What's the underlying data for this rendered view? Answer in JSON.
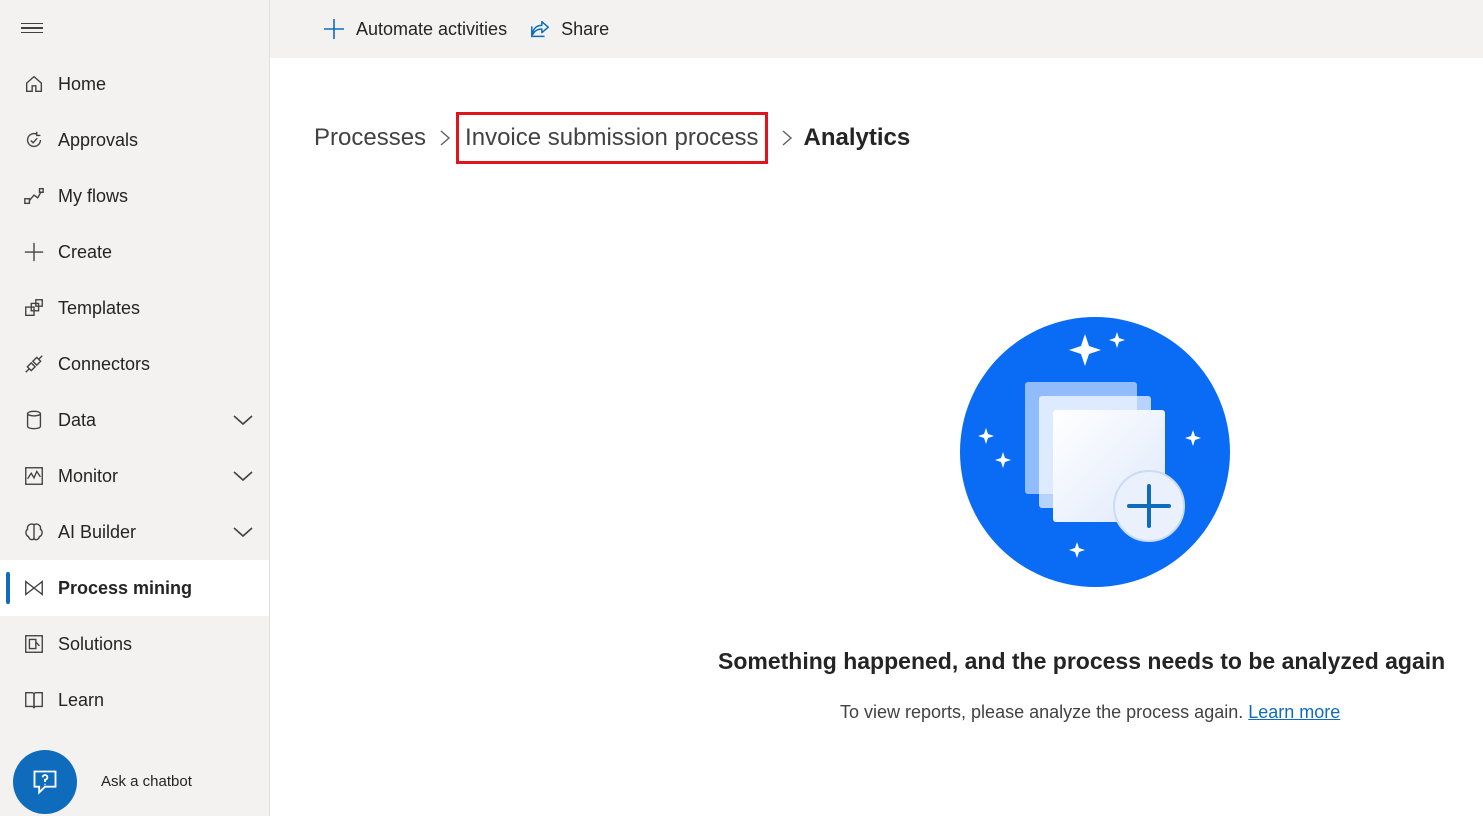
{
  "sidebar": {
    "items": [
      {
        "label": "Home",
        "icon": "home-icon",
        "active": false,
        "expandable": false
      },
      {
        "label": "Approvals",
        "icon": "approvals-icon",
        "active": false,
        "expandable": false
      },
      {
        "label": "My flows",
        "icon": "flows-icon",
        "active": false,
        "expandable": false
      },
      {
        "label": "Create",
        "icon": "plus-icon",
        "active": false,
        "expandable": false
      },
      {
        "label": "Templates",
        "icon": "templates-icon",
        "active": false,
        "expandable": false
      },
      {
        "label": "Connectors",
        "icon": "connectors-icon",
        "active": false,
        "expandable": false
      },
      {
        "label": "Data",
        "icon": "database-icon",
        "active": false,
        "expandable": true
      },
      {
        "label": "Monitor",
        "icon": "monitor-icon",
        "active": false,
        "expandable": true
      },
      {
        "label": "AI Builder",
        "icon": "brain-icon",
        "active": false,
        "expandable": true
      },
      {
        "label": "Process mining",
        "icon": "process-mining-icon",
        "active": true,
        "expandable": false
      },
      {
        "label": "Solutions",
        "icon": "solutions-icon",
        "active": false,
        "expandable": false
      },
      {
        "label": "Learn",
        "icon": "book-icon",
        "active": false,
        "expandable": false
      }
    ],
    "chatbot_label": "Ask a chatbot"
  },
  "toolbar": {
    "automate_label": "Automate activities",
    "share_label": "Share"
  },
  "breadcrumb": {
    "processes": "Processes",
    "process_name": "Invoice submission process",
    "current": "Analytics"
  },
  "message": {
    "title": "Something happened, and the process needs to be analyzed again",
    "body": "To view reports, please analyze the process again.",
    "link": "Learn more"
  },
  "colors": {
    "accent": "#0f6cbd",
    "illustration": "#0a6cf5",
    "highlight": "#e1141e",
    "sidebar_bg": "#f3f2f1"
  }
}
